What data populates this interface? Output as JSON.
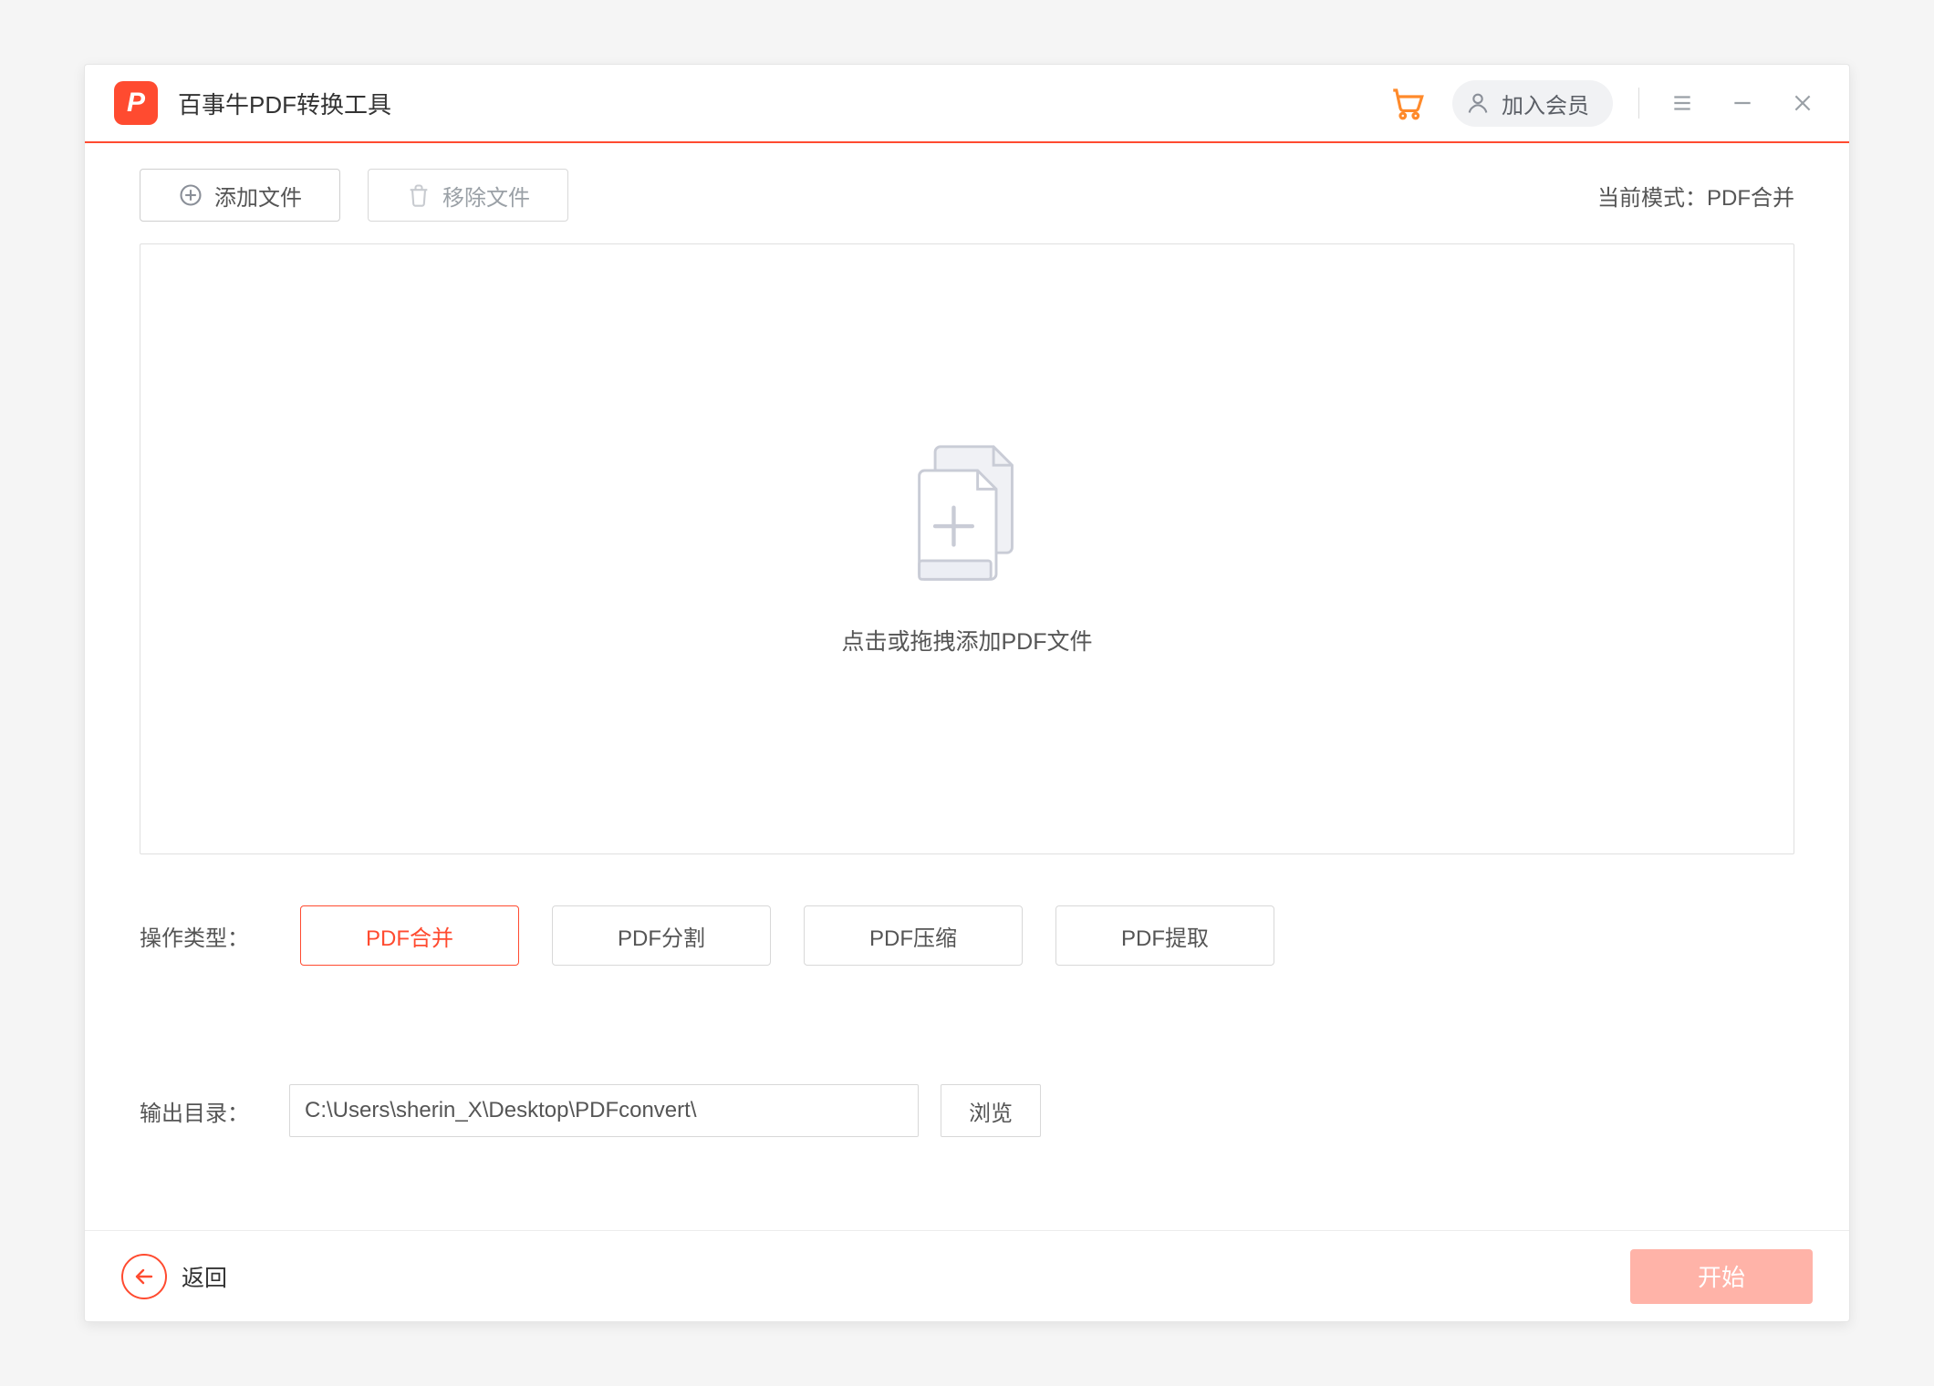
{
  "titlebar": {
    "app_title": "百事牛PDF转换工具",
    "member_label": "加入会员"
  },
  "toolbar": {
    "add_label": "添加文件",
    "remove_label": "移除文件",
    "mode_prefix": "当前模式：",
    "current_mode": "PDF合并"
  },
  "dropzone": {
    "hint": "点击或拖拽添加PDF文件"
  },
  "options": {
    "label": "操作类型：",
    "items": [
      "PDF合并",
      "PDF分割",
      "PDF压缩",
      "PDF提取"
    ],
    "active_index": 0
  },
  "output": {
    "label": "输出目录：",
    "path": "C:\\Users\\sherin_X\\Desktop\\PDFconvert\\",
    "browse_label": "浏览"
  },
  "footer": {
    "back_label": "返回",
    "start_label": "开始"
  }
}
